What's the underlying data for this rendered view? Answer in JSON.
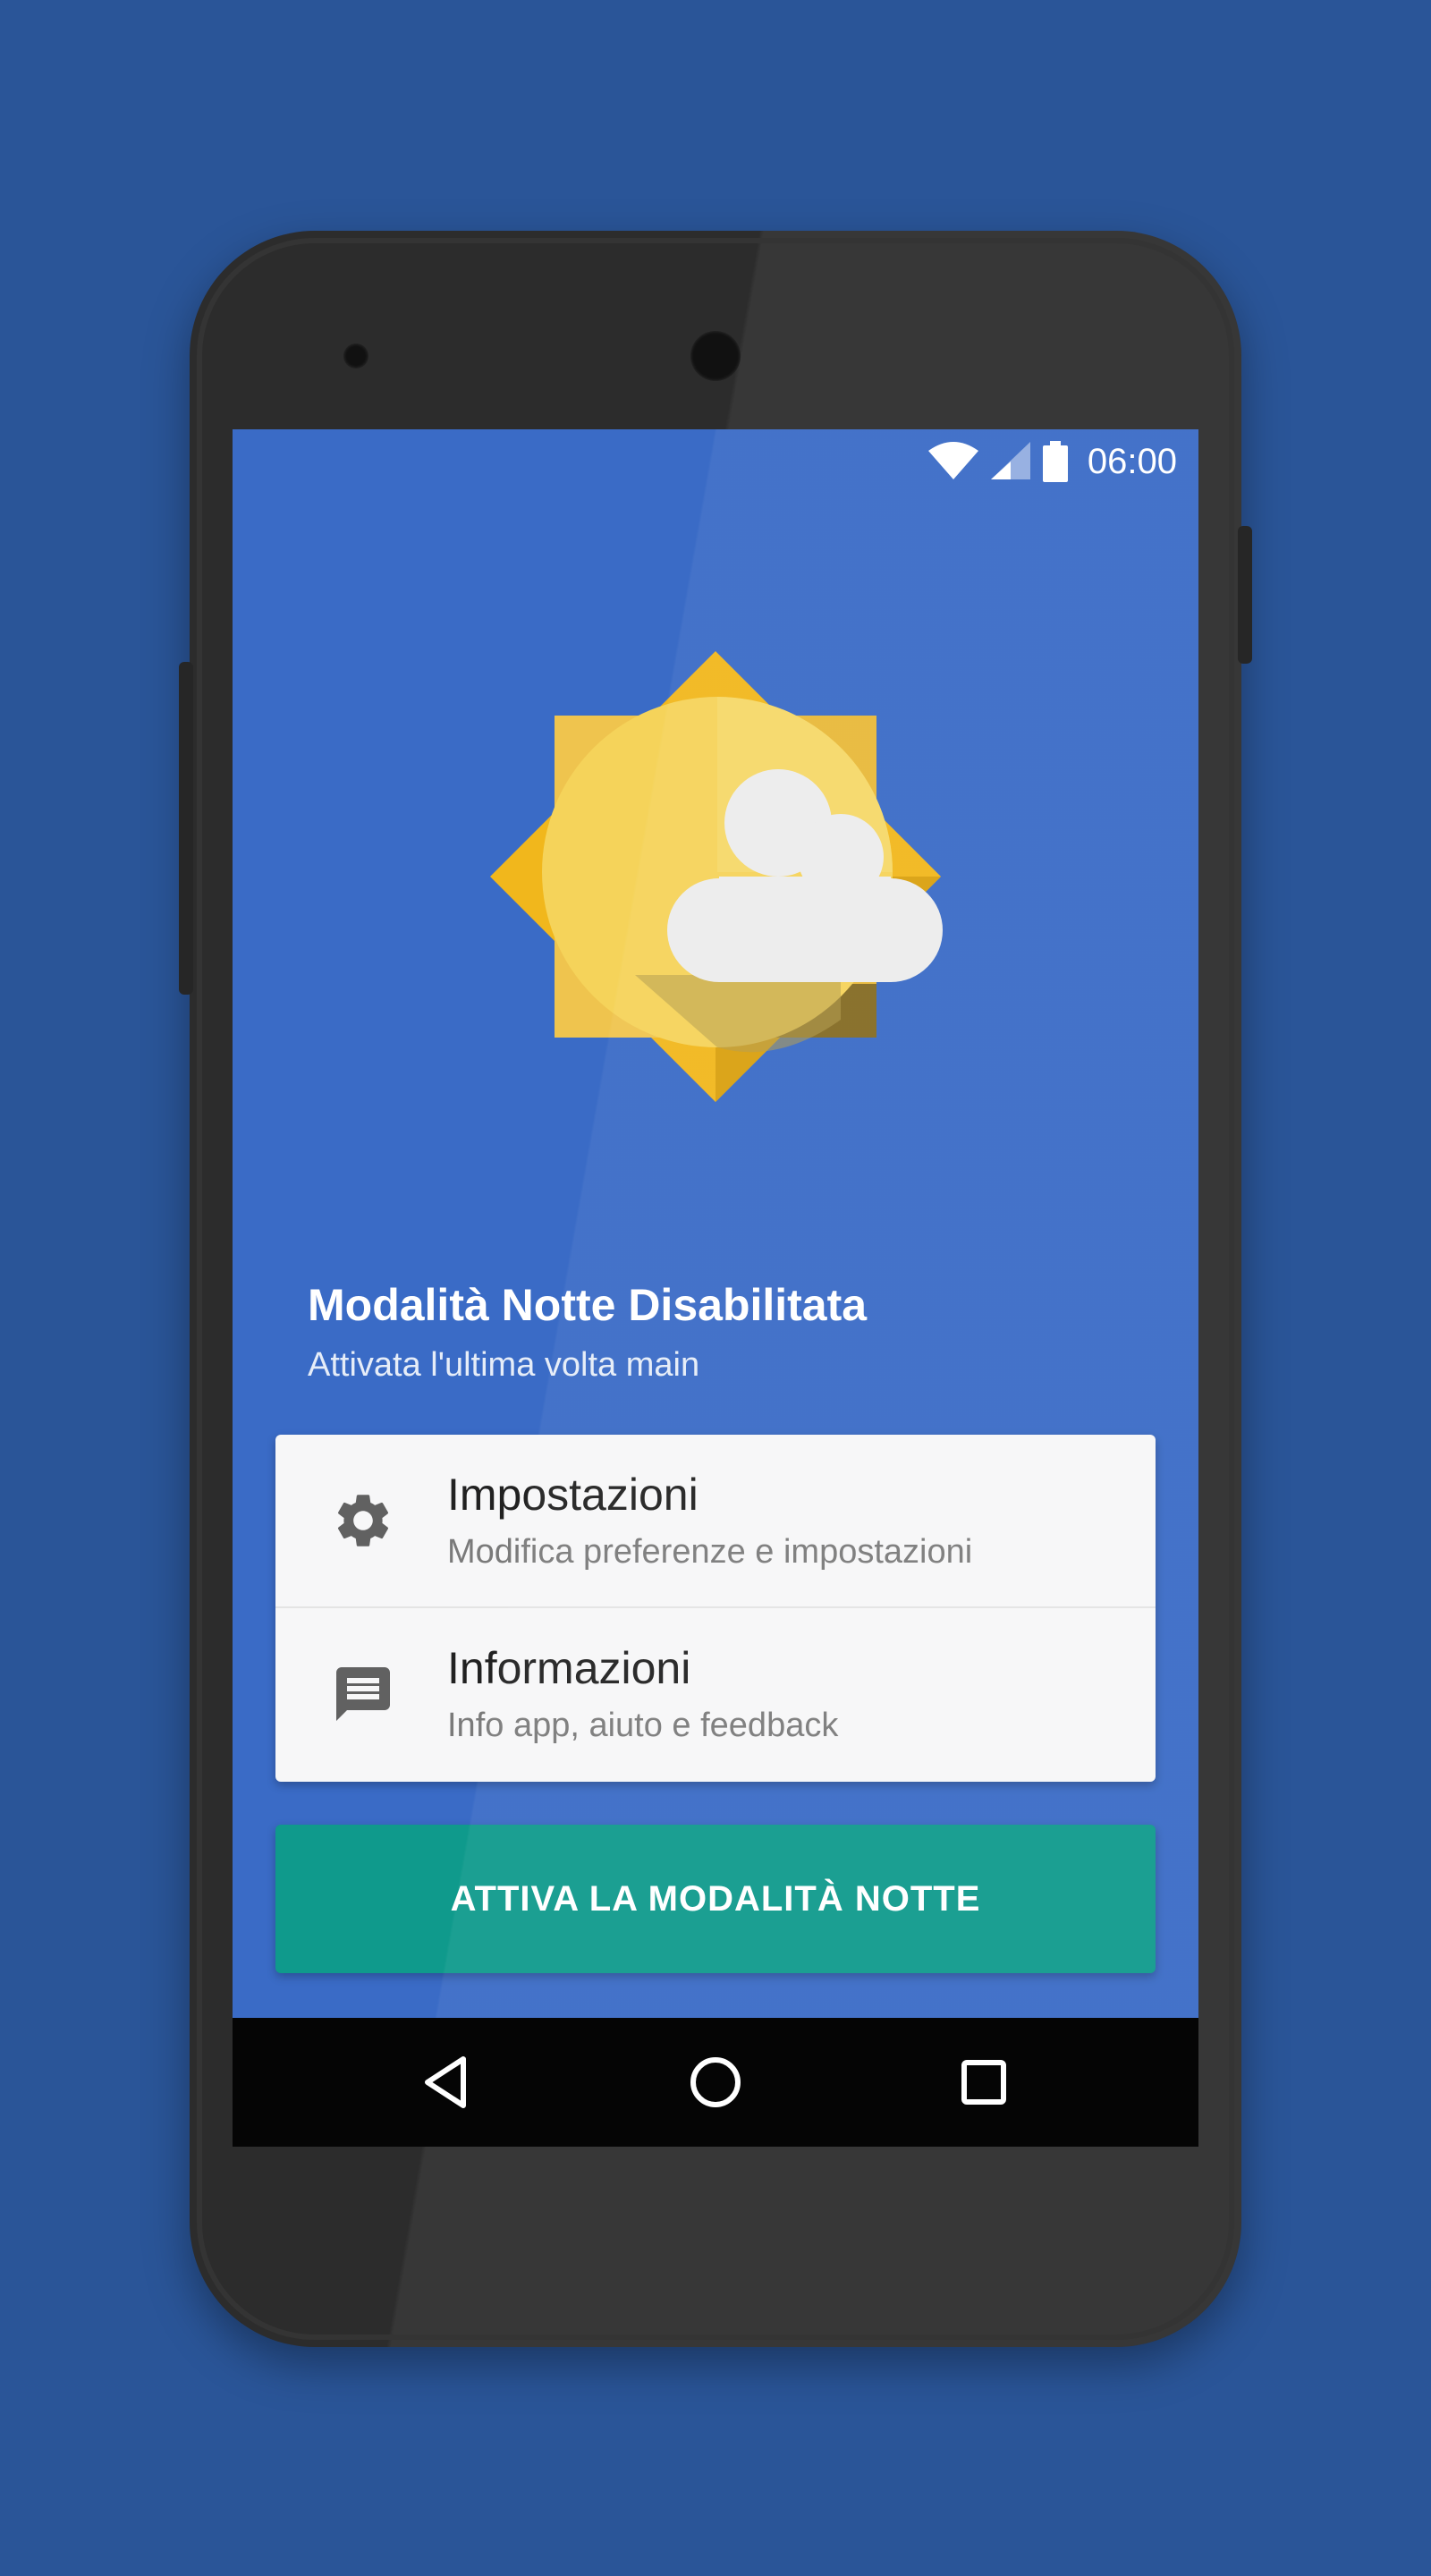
{
  "status_bar": {
    "time": "06:00",
    "icons": [
      "wifi-icon",
      "cell-signal-icon",
      "battery-icon"
    ]
  },
  "illustration": {
    "name": "sun-cloud-icon",
    "colors": {
      "sun_rays": "#f1b71c",
      "sun_body": "#f5d35a",
      "cloud": "#ececec"
    }
  },
  "main": {
    "title": "Modalità Notte Disabilitata",
    "subtitle": "Attivata l'ultima volta main"
  },
  "menu": {
    "items": [
      {
        "icon": "gear-icon",
        "title": "Impostazioni",
        "subtitle": "Modifica preferenze e impostazioni"
      },
      {
        "icon": "chat-icon",
        "title": "Informazioni",
        "subtitle": "Info app, aiuto e feedback"
      }
    ]
  },
  "action": {
    "label": "ATTIVA LA MODALITÀ NOTTE",
    "color": "#0f9a8c"
  },
  "nav_bar": {
    "buttons": [
      "back-icon",
      "home-icon",
      "recents-icon"
    ]
  },
  "colors": {
    "background": "#2a5598",
    "screen": "#3a6bc6",
    "phone": "#2c2c2c"
  }
}
